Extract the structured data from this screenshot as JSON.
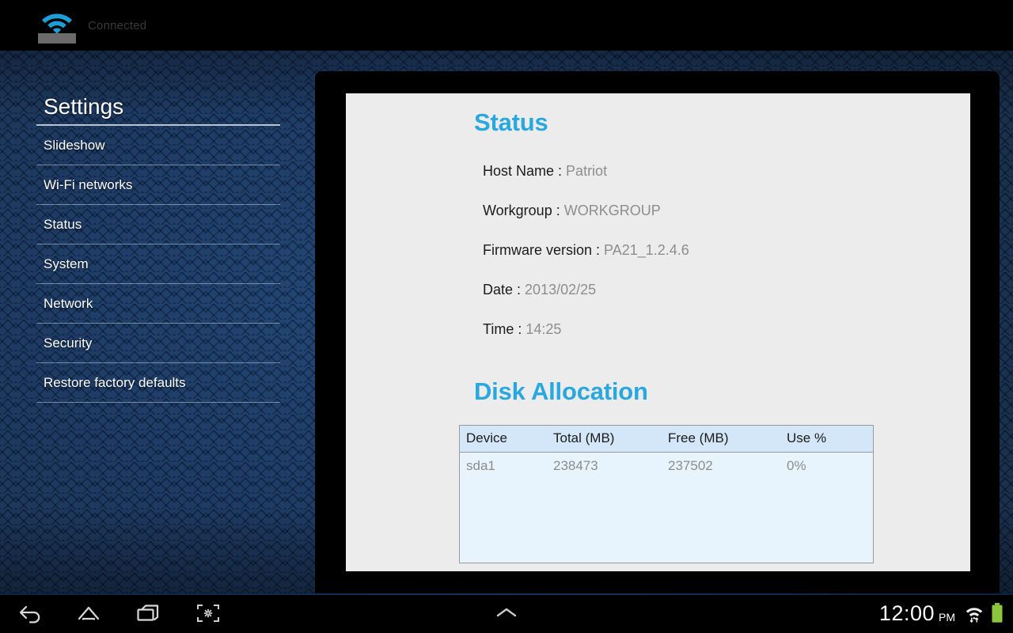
{
  "top_bar": {
    "wifi_icon": "wifi-connected-icon",
    "status_text": "Connected"
  },
  "sidebar": {
    "title": "Settings",
    "items": [
      {
        "label": "Slideshow"
      },
      {
        "label": "Wi-Fi networks"
      },
      {
        "label": "Status"
      },
      {
        "label": "System"
      },
      {
        "label": "Network"
      },
      {
        "label": "Security"
      },
      {
        "label": "Restore factory defaults"
      }
    ]
  },
  "main": {
    "status": {
      "heading": "Status",
      "rows": [
        {
          "label": "Host Name :",
          "value": "Patriot"
        },
        {
          "label": "Workgroup :",
          "value": "WORKGROUP"
        },
        {
          "label": "Firmware version :",
          "value": "PA21_1.2.4.6"
        },
        {
          "label": "Date :",
          "value": "2013/02/25"
        },
        {
          "label": "Time :",
          "value": "14:25"
        }
      ]
    },
    "disk_allocation": {
      "heading": "Disk Allocation",
      "columns": [
        "Device",
        "Total (MB)",
        "Free (MB)",
        "Use %"
      ],
      "rows": [
        [
          "sda1",
          "238473",
          "237502",
          "0%"
        ]
      ]
    }
  },
  "nav_bar": {
    "back_icon": "back-arrow-icon",
    "home_icon": "home-icon",
    "recents_icon": "recent-apps-icon",
    "capture_icon": "screenshot-icon",
    "expand_icon": "chevron-up-icon",
    "clock_time": "12:00",
    "clock_ampm": "PM",
    "wifi_icon": "wifi-signal-icon",
    "battery_icon": "battery-full-icon"
  },
  "colors": {
    "accent_heading": "#29a8e0",
    "wifi_blue": "#29a8e0",
    "wallpaper_blue": "#0d2a52",
    "panel_bg": "#ececec",
    "table_header_bg": "#d3e7f8",
    "table_body_bg": "#e7f3fd",
    "battery_green": "#8cc63f"
  }
}
